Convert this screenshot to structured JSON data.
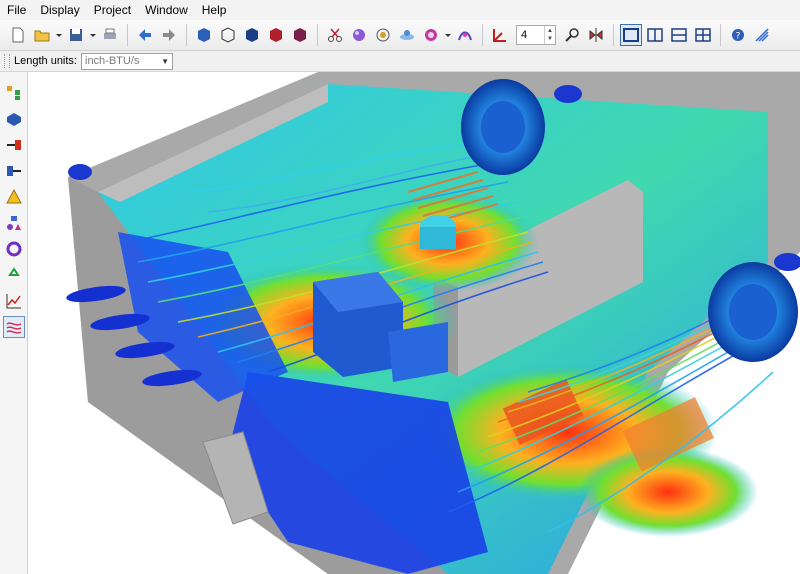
{
  "menu": [
    {
      "label": "File"
    },
    {
      "label": "Display"
    },
    {
      "label": "Project"
    },
    {
      "label": "Window"
    },
    {
      "label": "Help"
    }
  ],
  "toolbar": {
    "spinner_value": "4",
    "icons": [
      "new-file-icon",
      "open-folder-icon",
      "save-icon",
      "print-icon",
      "back-arrow-icon",
      "forward-arrow-icon",
      "solid-cube-icon",
      "wireframe-cube-icon",
      "shaded-cube-icon",
      "hidden-line-cube-icon",
      "color-cube-icon",
      "scissors-icon",
      "gradient-sphere-icon",
      "target-sphere-icon",
      "plane-icon",
      "color-map-icon",
      "contour-icon",
      "axis-icon",
      "probe-icon",
      "mirror-icon",
      "single-view-icon",
      "dual-vertical-view-icon",
      "dual-horizontal-view-icon",
      "quad-view-icon",
      "help-icon",
      "logo-icon"
    ]
  },
  "units": {
    "label": "Length units:",
    "value": "inch-BTU/s"
  },
  "sidebar": {
    "icons": [
      "tree-icon",
      "solid-block-icon",
      "flow-inlet-icon",
      "flow-outlet-icon",
      "warning-icon",
      "shapes-icon",
      "rotate-icon",
      "recycle-icon",
      "graph-icon",
      "streamline-icon"
    ]
  },
  "colors": {
    "accent": "#3a6fb0",
    "enclosure": "#a8a8a8",
    "flow_low": "#1030e0",
    "flow_high": "#e03010"
  }
}
